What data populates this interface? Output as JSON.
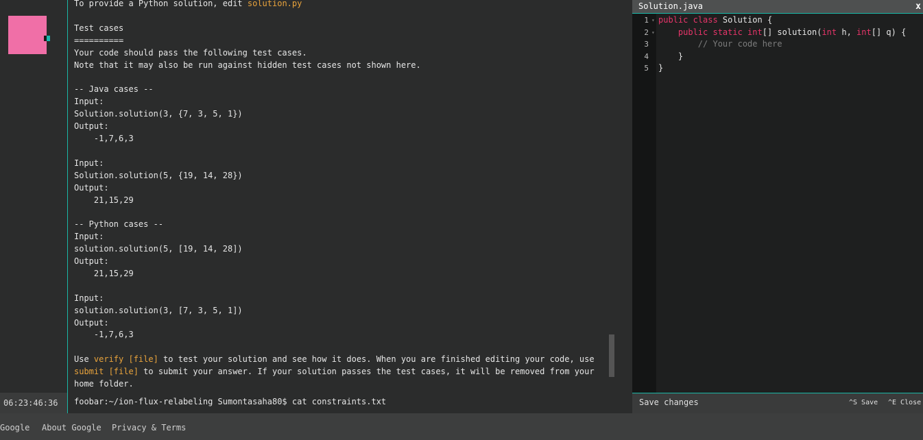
{
  "sidebar": {
    "clock": "06:23:46:36"
  },
  "terminal": {
    "lines": [
      [
        {
          "t": "To provide a Python solution, edit "
        },
        {
          "t": "solution.py",
          "c": "hl"
        }
      ],
      [
        {
          "t": ""
        }
      ],
      [
        {
          "t": "Test cases"
        }
      ],
      [
        {
          "t": "=========="
        }
      ],
      [
        {
          "t": "Your code should pass the following test cases."
        }
      ],
      [
        {
          "t": "Note that it may also be run against hidden test cases not shown here."
        }
      ],
      [
        {
          "t": ""
        }
      ],
      [
        {
          "t": "-- Java cases --"
        }
      ],
      [
        {
          "t": "Input:"
        }
      ],
      [
        {
          "t": "Solution.solution(3, {7, 3, 5, 1})"
        }
      ],
      [
        {
          "t": "Output:"
        }
      ],
      [
        {
          "t": "    -1,7,6,3"
        }
      ],
      [
        {
          "t": ""
        }
      ],
      [
        {
          "t": "Input:"
        }
      ],
      [
        {
          "t": "Solution.solution(5, {19, 14, 28})"
        }
      ],
      [
        {
          "t": "Output:"
        }
      ],
      [
        {
          "t": "    21,15,29"
        }
      ],
      [
        {
          "t": ""
        }
      ],
      [
        {
          "t": "-- Python cases --"
        }
      ],
      [
        {
          "t": "Input:"
        }
      ],
      [
        {
          "t": "solution.solution(5, [19, 14, 28])"
        }
      ],
      [
        {
          "t": "Output:"
        }
      ],
      [
        {
          "t": "    21,15,29"
        }
      ],
      [
        {
          "t": ""
        }
      ],
      [
        {
          "t": "Input:"
        }
      ],
      [
        {
          "t": "solution.solution(3, [7, 3, 5, 1])"
        }
      ],
      [
        {
          "t": "Output:"
        }
      ],
      [
        {
          "t": "    -1,7,6,3"
        }
      ],
      [
        {
          "t": ""
        }
      ],
      [
        {
          "t": "Use "
        },
        {
          "t": "verify [file]",
          "c": "hl"
        },
        {
          "t": " to test your solution and see how it does. When you are finished editing your code, use"
        }
      ],
      [
        {
          "t": "submit [file]",
          "c": "hl"
        },
        {
          "t": " to submit your answer. If your solution passes the test cases, it will be removed from your"
        }
      ],
      [
        {
          "t": "home folder."
        }
      ]
    ],
    "prompt": "foobar:~/ion-flux-relabeling Sumontasaha80$ cat constraints.txt"
  },
  "editor": {
    "filename": "Solution.java",
    "close_label": "x",
    "line_numbers": [
      "1",
      "2",
      "3",
      "4",
      "5"
    ],
    "code_lines": [
      [
        {
          "t": "public class",
          "c": "kw"
        },
        {
          "t": " Solution {"
        }
      ],
      [
        {
          "t": "    "
        },
        {
          "t": "public static int",
          "c": "kw"
        },
        {
          "t": "[] solution("
        },
        {
          "t": "int",
          "c": "kw"
        },
        {
          "t": " h, "
        },
        {
          "t": "int",
          "c": "kw"
        },
        {
          "t": "[] q) {"
        }
      ],
      [
        {
          "t": "        "
        },
        {
          "t": "// Your code here",
          "c": "cm"
        }
      ],
      [
        {
          "t": "    }"
        }
      ],
      [
        {
          "t": "}"
        }
      ]
    ],
    "footer": {
      "save_changes": "Save changes",
      "save_shortcut": "^S Save",
      "close_shortcut": "^E Close"
    }
  },
  "site_footer": {
    "links": [
      "Google",
      "About Google",
      "Privacy & Terms"
    ]
  }
}
